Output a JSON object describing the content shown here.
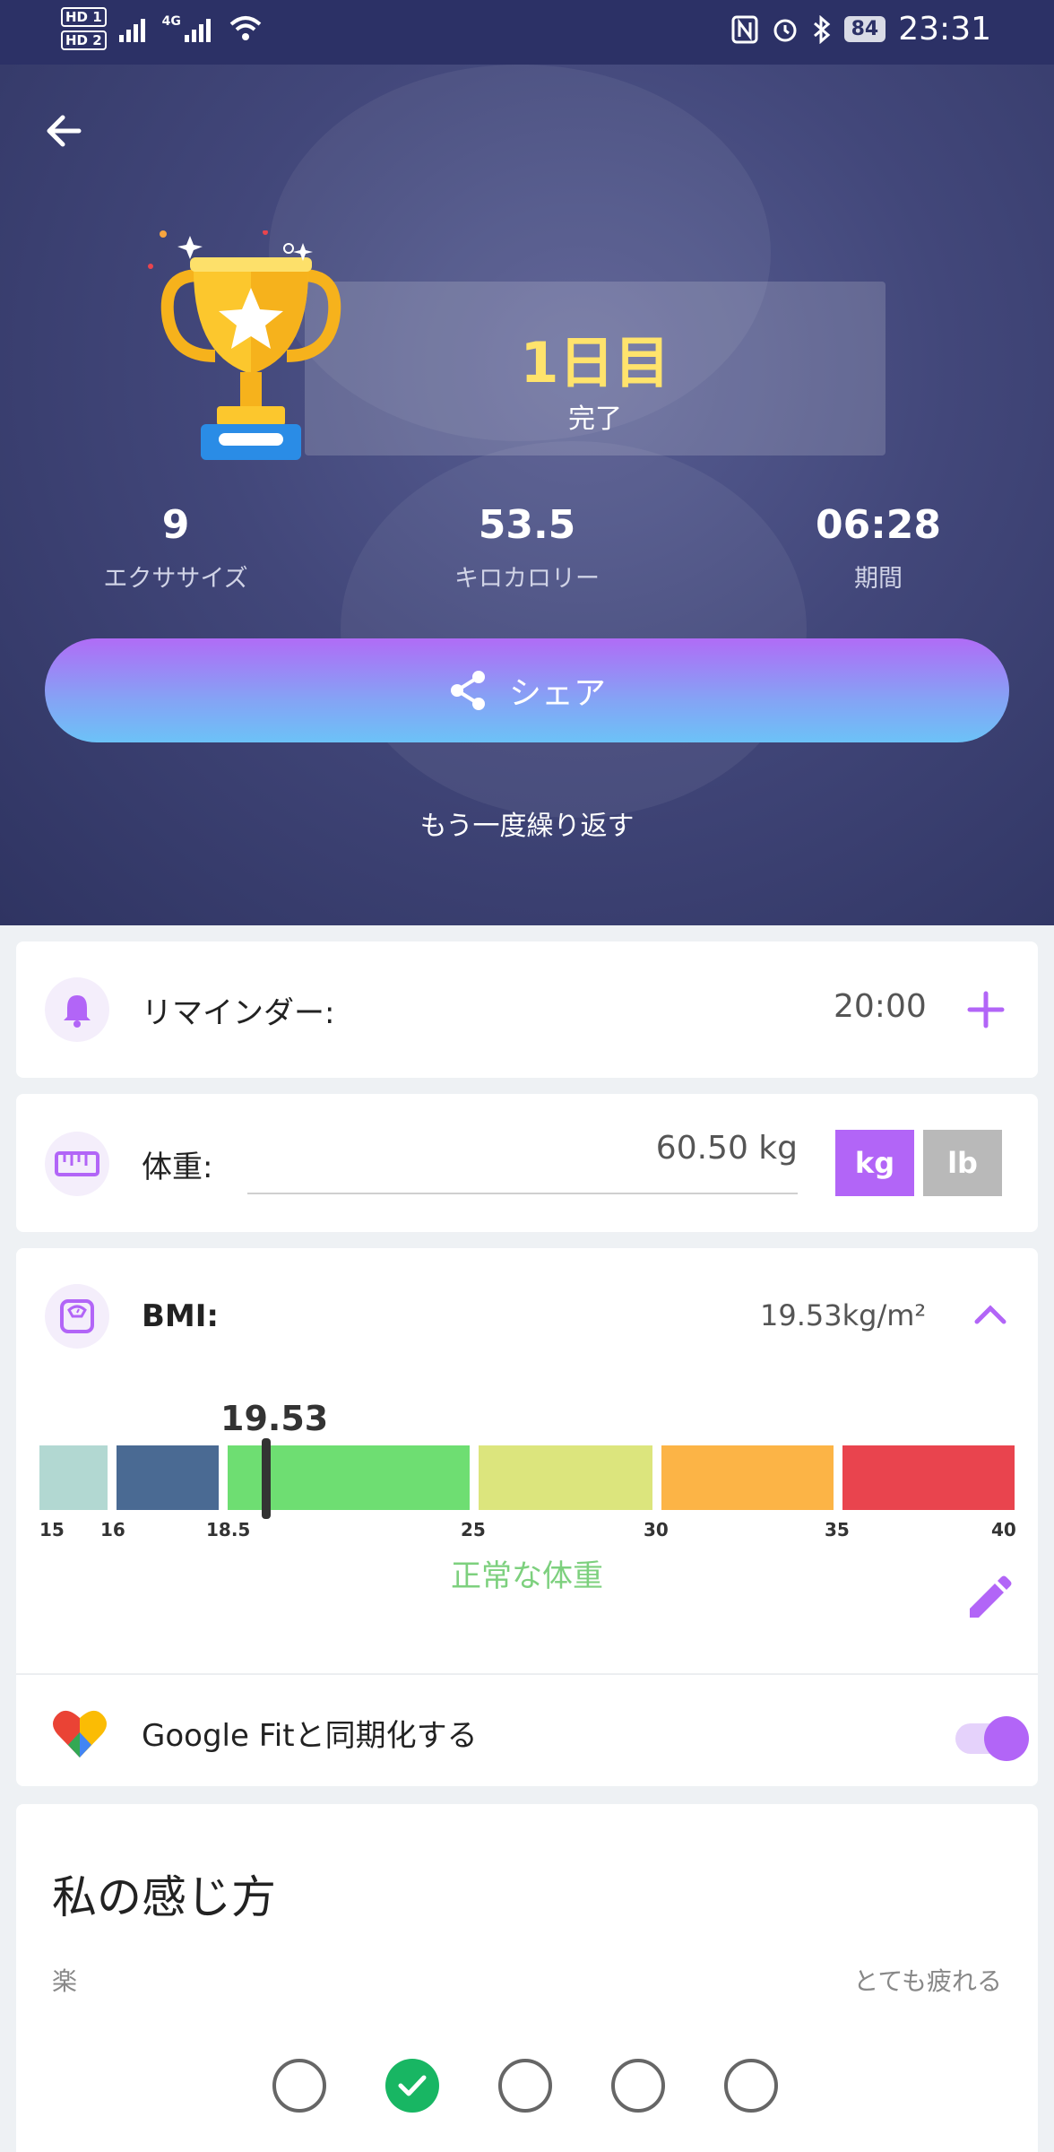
{
  "status_bar": {
    "sim1": "HD 1",
    "sim2": "HD 2",
    "network": "4G",
    "battery": "84",
    "time": "23:31"
  },
  "hero": {
    "day_title": "1日目",
    "day_subtitle": "完了",
    "stats": [
      {
        "value": "9",
        "label": "エクササイズ"
      },
      {
        "value": "53.5",
        "label": "キロカロリー"
      },
      {
        "value": "06:28",
        "label": "期間"
      }
    ],
    "share_label": "シェア",
    "repeat_label": "もう一度繰り返す"
  },
  "reminder": {
    "label": "リマインダー:",
    "time": "20:00",
    "icon": "bell-icon"
  },
  "weight": {
    "label": "体重:",
    "value": "60.50 kg",
    "unit_kg": "kg",
    "unit_lb": "lb",
    "selected_unit": "kg",
    "icon": "ruler-icon"
  },
  "bmi": {
    "label": "BMI:",
    "value_text": "19.53kg/m²",
    "marker_value": "19.53",
    "category": "正常な体重",
    "ticks": [
      "15",
      "16",
      "18.5",
      "25",
      "30",
      "35",
      "40"
    ],
    "segment_colors": [
      "#b2d8d2",
      "#4a6a93",
      "#6ede72",
      "#dce57d",
      "#fcb446",
      "#e9444e"
    ],
    "icon": "scale-icon"
  },
  "google_fit": {
    "label": "Google Fitと同期化する",
    "enabled": true,
    "icon": "google-fit-icon"
  },
  "feeling": {
    "title": "私の感じ方",
    "left_label": "楽",
    "right_label": "とても疲れる",
    "selected_index": 1,
    "option_count": 5
  },
  "colors": {
    "accent": "#b265f7",
    "header_bg": "#2c3166",
    "day_title": "#ffe36c",
    "normal_weight": "#7dd07e",
    "selected_check": "#18b663"
  }
}
